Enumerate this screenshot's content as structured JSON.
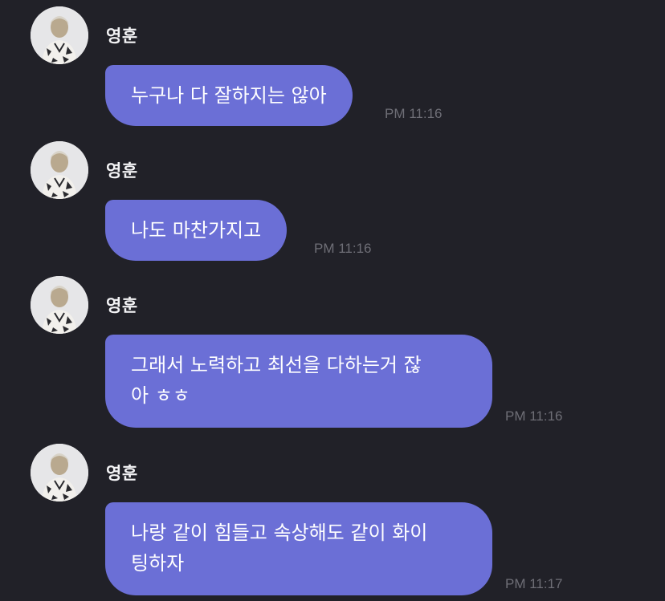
{
  "colors": {
    "background": "#212128",
    "bubble": "#6b6fd6",
    "bubble_text": "#ffffff",
    "sender_text": "#f3f3f5",
    "time_text": "#6e6e76"
  },
  "messages": [
    {
      "sender": "영훈",
      "text": "누구나 다 잘하지는 않아",
      "time": "PM 11:16"
    },
    {
      "sender": "영훈",
      "text": "나도 마찬가지고",
      "time": "PM 11:16"
    },
    {
      "sender": "영훈",
      "text": "그래서 노력하고 최선을 다하는거 잖\n아 ㅎㅎ",
      "time": "PM 11:16"
    },
    {
      "sender": "영훈",
      "text": "나랑 같이 힘들고 속상해도 같이 화이\n팅하자",
      "time": "PM 11:17"
    }
  ]
}
